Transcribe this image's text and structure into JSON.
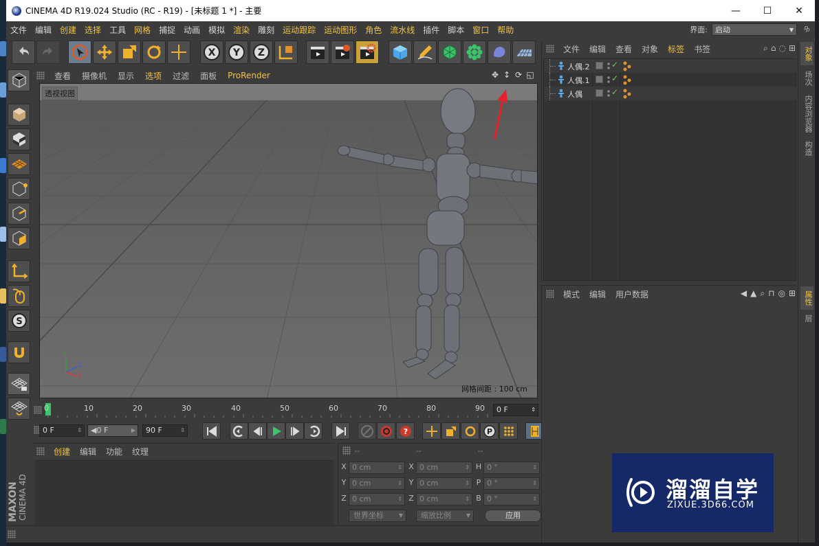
{
  "window": {
    "title": "CINEMA 4D R19.024 Studio (RC - R19) - [未标题 1 *] - 主要",
    "minimize": "—",
    "maximize": "☐",
    "close": "✕"
  },
  "menu": {
    "items": [
      "文件",
      "编辑",
      "创建",
      "选择",
      "工具",
      "网格",
      "捕捉",
      "动画",
      "模拟",
      "渲染",
      "雕刻",
      "运动跟踪",
      "运动图形",
      "角色",
      "流水线",
      "插件",
      "脚本",
      "窗口",
      "帮助"
    ],
    "highlighted": [
      "创建",
      "选择",
      "网格",
      "渲染",
      "运动跟踪",
      "运动图形",
      "角色",
      "流水线",
      "窗口",
      "帮助"
    ],
    "layout_label": "界面:",
    "layout_value": "启动"
  },
  "viewport": {
    "menu": [
      "查看",
      "摄像机",
      "显示",
      "选项",
      "过滤",
      "面板",
      "ProRender"
    ],
    "highlighted": [
      "选项",
      "ProRender"
    ],
    "view_name": "透视视图",
    "grid_info": "网格间距 : 100 cm",
    "axis_labels": {
      "y": "Y",
      "z": "Z",
      "x": "X"
    }
  },
  "timeline": {
    "ticks": [
      "0",
      "10",
      "20",
      "30",
      "40",
      "50",
      "60",
      "70",
      "80",
      "90"
    ],
    "current_frame": "0 F"
  },
  "transport": {
    "start": "0 F",
    "preview": "0 F",
    "end": "90 F"
  },
  "material_panel": {
    "menu": [
      "创建",
      "编辑",
      "功能",
      "纹理"
    ],
    "highlighted": "创建"
  },
  "coordinates": {
    "headers": [
      "--",
      "--",
      "--"
    ],
    "rows": [
      {
        "a1": "X",
        "v1": "0 cm",
        "a2": "X",
        "v2": "0 cm",
        "a3": "H",
        "v3": "0 °"
      },
      {
        "a1": "Y",
        "v1": "0 cm",
        "a2": "Y",
        "v2": "0 cm",
        "a3": "P",
        "v3": "0 °"
      },
      {
        "a1": "Z",
        "v1": "0 cm",
        "a2": "Z",
        "v2": "0 cm",
        "a3": "B",
        "v3": "0 °"
      }
    ],
    "space": "世界坐标",
    "scale": "缩放比例",
    "apply": "应用"
  },
  "object_manager": {
    "menu": [
      "文件",
      "编辑",
      "查看",
      "对象",
      "标签",
      "书签"
    ],
    "highlighted": "标签",
    "objects": [
      "人偶.2",
      "人偶.1",
      "人偶"
    ]
  },
  "attribute_manager": {
    "menu": [
      "模式",
      "编辑",
      "用户数据"
    ]
  },
  "side_tabs": {
    "top": [
      "对象",
      "场次",
      "内容浏览器",
      "构造"
    ],
    "bottom": [
      "属性",
      "层"
    ]
  },
  "watermark": {
    "title": "溜溜自学",
    "url": "ZIXUE.3D66.COM"
  },
  "maxon_logo": {
    "brand": "MAXON",
    "product": "CINEMA 4D"
  },
  "colors": {
    "ui_bg": "#3b3b3b",
    "highlight_text": "#f2c243",
    "viewport_bg": "#6a6a6a",
    "watermark_bg": "#12286e"
  }
}
